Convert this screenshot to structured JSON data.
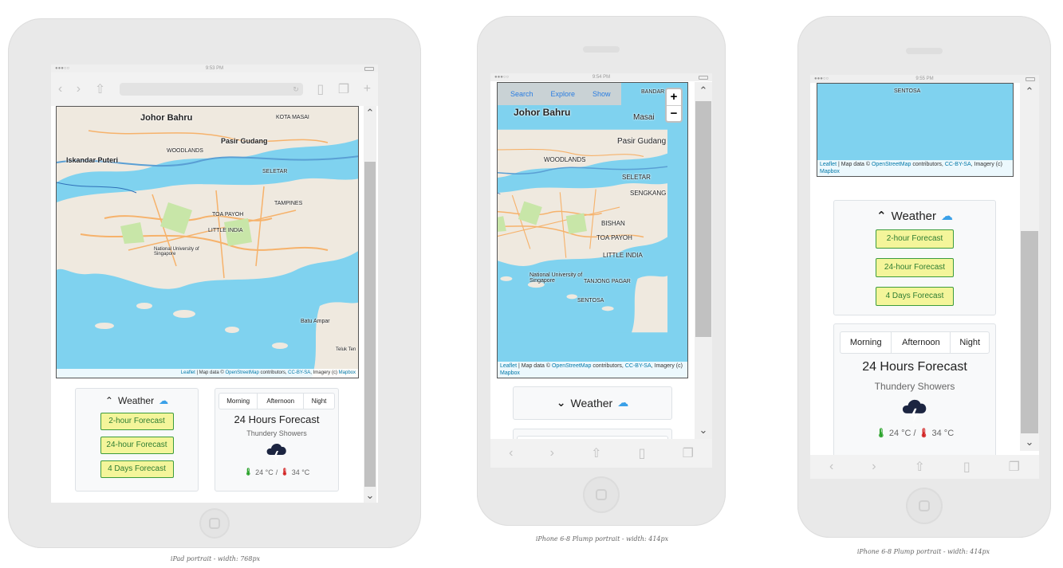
{
  "map": {
    "labels": {
      "johor_bahru": "Johor Bahru",
      "pasir_gudang": "Pasir Gudang",
      "iskandar_puteri": "Iskandar Puteri",
      "masai": "Masai",
      "woodlands": "WOODLANDS",
      "seletar": "SELETAR",
      "sengkang": "SENGKANG",
      "tampines": "TAMPINES",
      "bishan": "BISHAN",
      "toa_payoh": "TOA PAYOH",
      "little_india": "LITTLE INDIA",
      "tanjong_pagar": "TANJONG PAGAR",
      "sentosa": "SENTOSA",
      "nus": "National University of Singapore",
      "batu_ampar": "Batu Ampar",
      "teluk": "Teluk Ten",
      "kota_masai": "KOTA MASAI",
      "bandar_baru": "BANDAR BARU"
    },
    "attribution": {
      "leaflet": "Leaflet",
      "text1": " | Map data © ",
      "osm": "OpenStreetMap",
      "text2": " contributors, ",
      "license": "CC-BY-SA",
      "text3": ", Imagery (c) ",
      "mapbox": "Mapbox"
    },
    "zoom_in": "+",
    "zoom_out": "−"
  },
  "status": {
    "ipad_time": "9:53 PM",
    "phone1_time": "9:54 PM",
    "phone2_time": "9:55 PM",
    "signal": "●●●○○"
  },
  "menu": {
    "search": "Search",
    "explore": "Explore",
    "show": "Show"
  },
  "weather": {
    "title": "Weather",
    "buttons": [
      "2-hour Forecast",
      "24-hour Forecast",
      "4 Days Forecast"
    ],
    "tabs": [
      "Morning",
      "Afternoon",
      "Night"
    ],
    "forecast_title": "24 Hours Forecast",
    "condition": "Thundery Showers",
    "low": "24 °C",
    "separator": "/",
    "high": "34 °C"
  },
  "captions": {
    "ipad": "iPad portrait - width: 768px",
    "iphone1": "iPhone 6-8 Plump portrait - width: 414px",
    "iphone2": "iPhone 6-8 Plump portrait - width: 414px"
  },
  "colors": {
    "sea": "#7fd2ef",
    "button_bg": "#f4f59a",
    "button_border": "#3c9c3c",
    "storm_icon": "#1c2541"
  }
}
